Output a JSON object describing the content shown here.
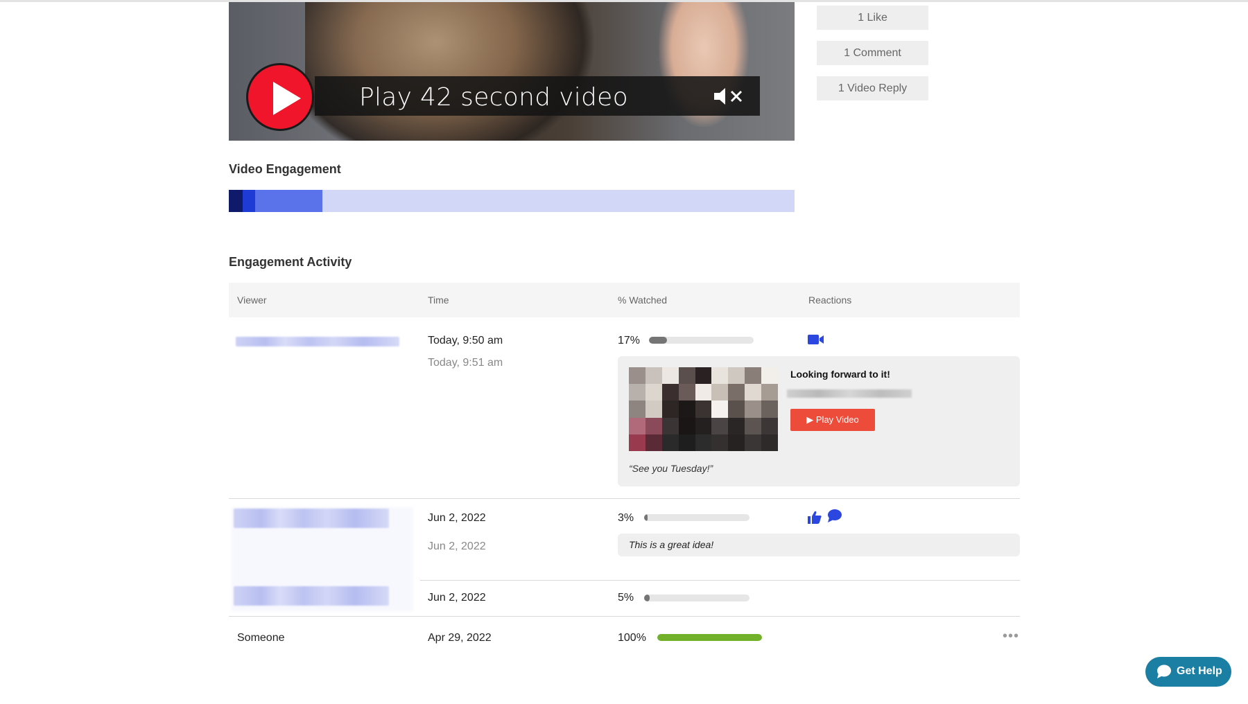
{
  "video": {
    "play_label": "Play 42 second video",
    "play_icon": "play-circle-icon",
    "mute_icon": "speaker-muted-icon"
  },
  "counters": {
    "likes": "1 Like",
    "comments": "1 Comment",
    "video_replies": "1 Video Reply"
  },
  "engagement": {
    "title": "Video Engagement",
    "segments": [
      {
        "share": 0.024,
        "color": "#101a6b"
      },
      {
        "share": 0.022,
        "color": "#1e3bd6"
      },
      {
        "share": 0.12,
        "color": "#5b73ea"
      },
      {
        "share": 0.834,
        "color": "#d2d6f7"
      }
    ]
  },
  "activity": {
    "title": "Engagement Activity",
    "columns": [
      "Viewer",
      "Time",
      "% Watched",
      "Reactions"
    ],
    "rows": [
      {
        "viewer": "",
        "time": "Today, 9:50 am",
        "time2": "Today, 9:51 am",
        "percent": "17%",
        "progress": 0.17,
        "reactions": [
          "video-camera-icon"
        ],
        "reply": {
          "title": "Looking forward to it!",
          "button": "▶ Play Video",
          "quote": "“See you Tuesday!”"
        }
      },
      {
        "viewer": "",
        "time": "Jun 2, 2022",
        "time2": "Jun 2, 2022",
        "percent": "3%",
        "progress": 0.03,
        "reactions": [
          "thumbs-up-icon",
          "comment-icon"
        ],
        "comment": "This is a great idea!"
      },
      {
        "viewer": "",
        "time": "Jun 2, 2022",
        "percent": "5%",
        "progress": 0.05
      },
      {
        "viewer": "Someone",
        "time": "Apr 29, 2022",
        "percent": "100%",
        "progress": 1.0,
        "menu_icon": "more-dots-icon"
      }
    ]
  },
  "help": {
    "label": "Get Help",
    "icon": "chat-bubble-icon"
  }
}
